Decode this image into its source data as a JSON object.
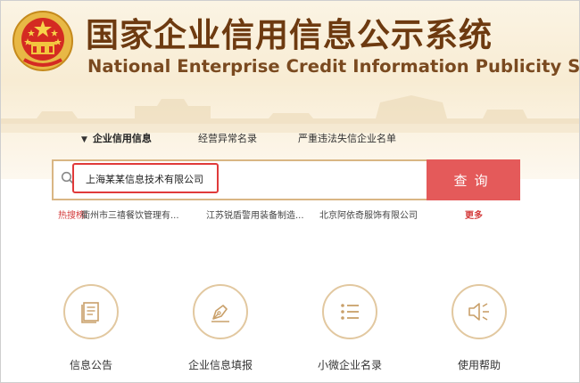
{
  "header": {
    "title_cn": "国家企业信用信息公示系统",
    "title_en": "National Enterprise Credit Information Publicity System"
  },
  "tabs": [
    {
      "label": "企业信用信息",
      "active": true
    },
    {
      "label": "经营异常名录",
      "active": false
    },
    {
      "label": "严重违法失信企业名单",
      "active": false
    }
  ],
  "search": {
    "value": "上海某某信息技术有限公司",
    "button_label": "查询"
  },
  "hot_searches": {
    "label": "热搜榜:",
    "items": [
      "衢州市三禧餐饮管理有...",
      "江苏锐盾警用装备制造...",
      "北京阿依奇服饰有限公司"
    ],
    "more_label": "更多"
  },
  "services": [
    {
      "label": "信息公告",
      "icon": "document-icon"
    },
    {
      "label": "企业信息填报",
      "icon": "pen-icon"
    },
    {
      "label": "小微企业名录",
      "icon": "list-icon"
    },
    {
      "label": "使用帮助",
      "icon": "speaker-icon"
    }
  ],
  "colors": {
    "brand_brown": "#6d3a10",
    "search_button": "#e45a5a",
    "hot_red": "#d43c3c",
    "highlight_red": "#e03a3a",
    "circle_border": "#e2c8a0"
  }
}
